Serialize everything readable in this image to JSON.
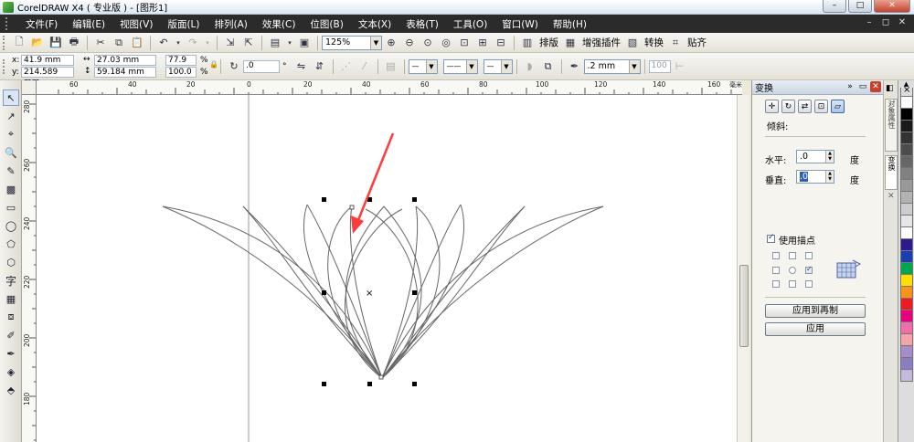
{
  "window": {
    "title": "CorelDRAW X4 ( 专业版 ) - [图形1]",
    "buttons": [
      "–",
      "□",
      "✕"
    ]
  },
  "menu": {
    "items": [
      "文件(F)",
      "编辑(E)",
      "视图(V)",
      "版面(L)",
      "排列(A)",
      "效果(C)",
      "位图(B)",
      "文本(X)",
      "表格(T)",
      "工具(O)",
      "窗口(W)",
      "帮助(H)"
    ],
    "right": [
      "–",
      "◻",
      "✕"
    ]
  },
  "toolbar1": {
    "zoom": "125%",
    "text_buttons": [
      "排版",
      "增强插件",
      "转换",
      "贴齐"
    ]
  },
  "propbar": {
    "x_label": "x:",
    "x": "41.9 mm",
    "y_label": "y:",
    "y": "214.589 mm",
    "width": "27.03 mm",
    "height": "59.184 mm",
    "scale_w": "77.9",
    "scale_h": "100.0",
    "percent": "%",
    "rotation": ".0",
    "degree": "°",
    "outline": ".2 mm",
    "value_100": "100"
  },
  "ruler": {
    "h_labels": [
      "60",
      "40",
      "20",
      "0",
      "20",
      "40",
      "60",
      "80",
      "100",
      "120",
      "140",
      "160",
      "毫米"
    ],
    "v_labels": [
      "280",
      "260",
      "240",
      "220",
      "200",
      "180"
    ]
  },
  "docker": {
    "title": "变换",
    "section": "倾斜:",
    "horizontal_label": "水平:",
    "horizontal_value": ".0",
    "vertical_label": "垂直:",
    "vertical_value": ".0",
    "unit": "度",
    "anchor_label": "使用描点",
    "apply_duplicate": "应用到再制",
    "apply": "应用"
  },
  "sidetabs": [
    "对象属性",
    "变换"
  ],
  "palette": [
    "#ffffff",
    "#000000",
    "#1a1a1a",
    "#333333",
    "#4d4d4d",
    "#666666",
    "#808080",
    "#999999",
    "#b3b3b3",
    "#cccccc",
    "#e6e6e6",
    "#ffffff",
    "#2e1a8a",
    "#1a3fb5",
    "#00a651",
    "#ffde00",
    "#f7941d",
    "#ed1c24",
    "#e4007c",
    "#f06ea9",
    "#f4a6a6",
    "#a48ec7",
    "#8b7cc4",
    "#c6b8dd"
  ],
  "colors": {
    "accent_arrow": "#ff3b3b",
    "menubar": "#2b2b2b",
    "curve": "#555555"
  }
}
